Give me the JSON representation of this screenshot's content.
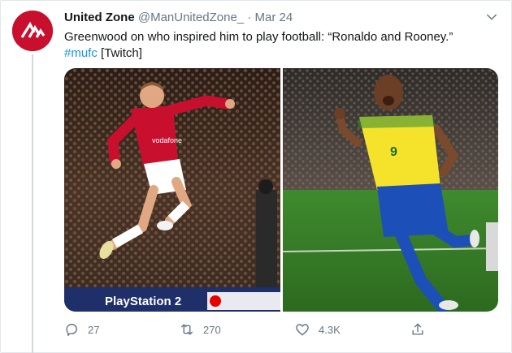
{
  "tweet": {
    "author_name": "United Zone",
    "handle": "@ManUnitedZone_",
    "separator": "·",
    "date": "Mar 24",
    "text_main": "Greenwood on who inspired him to play football: “Ronaldo and Rooney.”",
    "hashtag": "#mufc",
    "text_tail": " [Twitch]"
  },
  "media": {
    "left_image": {
      "ad_board_1": "PlayStation 2",
      "ad_board_2": "Vodafone",
      "shirt_sponsor": "vodafone",
      "colors": {
        "kit": "#c8102e",
        "shorts": "#ffffff"
      }
    },
    "right_image": {
      "shirt_number": "9",
      "colors": {
        "kit": "#f4e22b",
        "shorts": "#1d4fb8"
      }
    }
  },
  "actions": {
    "reply_count": "27",
    "retweet_count": "270",
    "like_count": "4.3K"
  },
  "icons": [
    "avatar-logo",
    "chevron-down-icon",
    "reply-icon",
    "retweet-icon",
    "like-icon",
    "share-icon"
  ],
  "colors": {
    "accent": "#1b95e0",
    "secondary_text": "#657786",
    "brand": "#c8102e"
  }
}
